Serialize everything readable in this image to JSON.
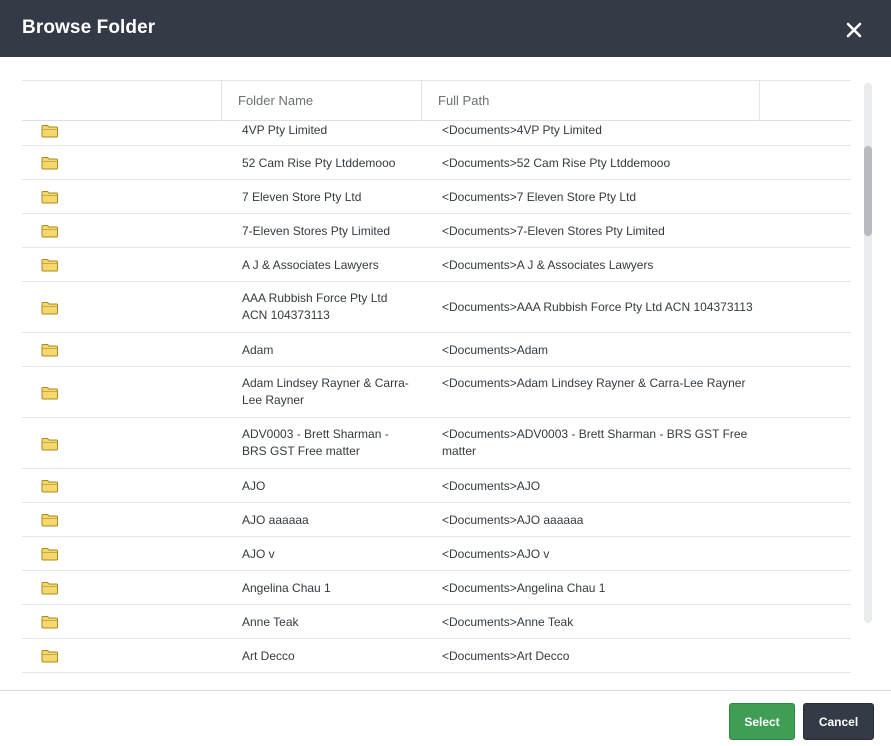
{
  "dialog": {
    "title": "Browse Folder",
    "close_icon": "close-icon"
  },
  "grid": {
    "columns": [
      "",
      "Folder Name",
      "Full Path"
    ],
    "rows": [
      {
        "name": "4VP Pty Limited",
        "path": "<Documents>4VP Pty Limited"
      },
      {
        "name": "52 Cam Rise Pty Ltddemooo",
        "path": "<Documents>52 Cam Rise Pty Ltddemooo"
      },
      {
        "name": "7 Eleven Store Pty Ltd",
        "path": "<Documents>7 Eleven Store Pty Ltd"
      },
      {
        "name": "7-Eleven Stores Pty Limited",
        "path": "<Documents>7-Eleven Stores Pty Limited"
      },
      {
        "name": "A J & Associates Lawyers",
        "path": "<Documents>A J & Associates Lawyers"
      },
      {
        "name": "AAA Rubbish Force Pty Ltd ACN 104373113",
        "path": "<Documents>AAA Rubbish Force Pty Ltd ACN 104373113"
      },
      {
        "name": "Adam",
        "path": "<Documents>Adam"
      },
      {
        "name": "Adam Lindsey Rayner & Carra-Lee Rayner",
        "path": "<Documents>Adam Lindsey Rayner & Carra-Lee Rayner"
      },
      {
        "name": "ADV0003 - Brett Sharman - BRS GST Free matter",
        "path": "<Documents>ADV0003 - Brett Sharman - BRS GST Free matter"
      },
      {
        "name": "AJO",
        "path": "<Documents>AJO"
      },
      {
        "name": "AJO aaaaaa",
        "path": "<Documents>AJO aaaaaa"
      },
      {
        "name": "AJO v",
        "path": "<Documents>AJO v"
      },
      {
        "name": "Angelina Chau 1",
        "path": "<Documents>Angelina Chau 1"
      },
      {
        "name": "Anne Teak",
        "path": "<Documents>Anne Teak"
      },
      {
        "name": "Art Decco",
        "path": "<Documents>Art Decco"
      }
    ],
    "row_icon": "folder-icon"
  },
  "footer": {
    "select_label": "Select",
    "cancel_label": "Cancel"
  },
  "colors": {
    "header_bg": "#343a46",
    "select_bg": "#3f9d55",
    "cancel_bg": "#343a46",
    "folder_fill": "#f5d76e",
    "folder_stroke": "#a88a1e"
  }
}
